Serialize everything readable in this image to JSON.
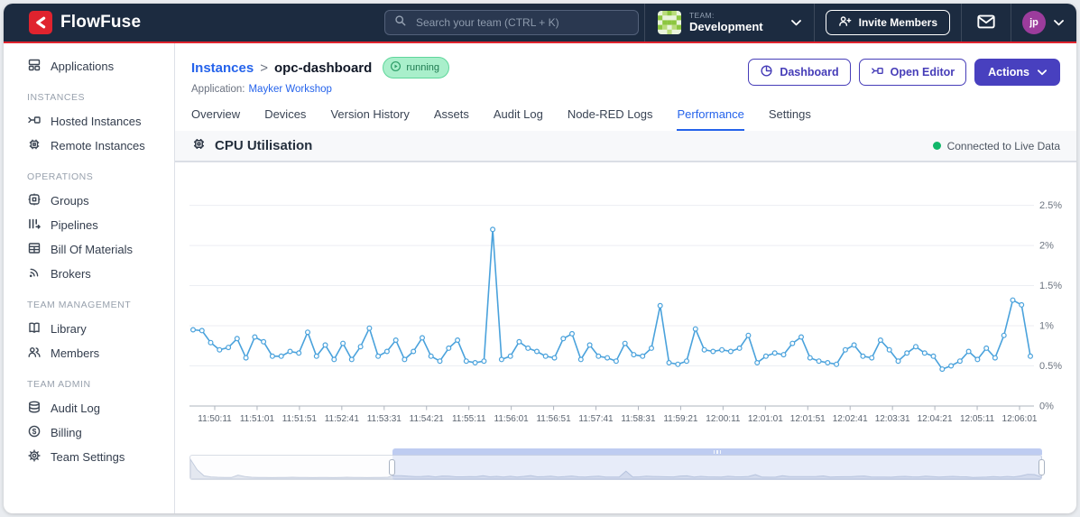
{
  "navbar": {
    "brand": "FlowFuse",
    "search_placeholder": "Search your team (CTRL + K)",
    "team_label": "TEAM:",
    "team_name": "Development",
    "invite_button": "Invite Members",
    "avatar_initials": "jp"
  },
  "sidebar": {
    "sections": [
      {
        "heading": "",
        "items": [
          {
            "label": "Applications"
          }
        ]
      },
      {
        "heading": "INSTANCES",
        "items": [
          {
            "label": "Hosted Instances"
          },
          {
            "label": "Remote Instances"
          }
        ]
      },
      {
        "heading": "OPERATIONS",
        "items": [
          {
            "label": "Groups"
          },
          {
            "label": "Pipelines"
          },
          {
            "label": "Bill Of Materials"
          },
          {
            "label": "Brokers"
          }
        ]
      },
      {
        "heading": "TEAM MANAGEMENT",
        "items": [
          {
            "label": "Library"
          },
          {
            "label": "Members"
          }
        ]
      },
      {
        "heading": "TEAM ADMIN",
        "items": [
          {
            "label": "Audit Log"
          },
          {
            "label": "Billing"
          },
          {
            "label": "Team Settings"
          }
        ]
      }
    ]
  },
  "header": {
    "breadcrumb_parent": "Instances",
    "breadcrumb_separator": ">",
    "instance_name": "opc-dashboard",
    "status_badge": "running",
    "application_label": "Application:",
    "application_name": "Mayker Workshop",
    "buttons": {
      "dashboard": "Dashboard",
      "open_editor": "Open Editor",
      "actions": "Actions"
    }
  },
  "tabs": [
    {
      "label": "Overview"
    },
    {
      "label": "Devices"
    },
    {
      "label": "Version History"
    },
    {
      "label": "Assets"
    },
    {
      "label": "Audit Log"
    },
    {
      "label": "Node-RED Logs"
    },
    {
      "label": "Performance"
    },
    {
      "label": "Settings"
    }
  ],
  "active_tab": "Performance",
  "colors": {
    "navbar_bg": "#1C2B40",
    "accent_red": "#E0232E",
    "link_blue": "#2563EB",
    "indigo": "#4840BF",
    "line_blue": "#4AA2DC",
    "live_green": "#12B76A",
    "badge_bg": "#A9EFCB",
    "badge_text": "#1E7A50"
  },
  "chart_data": {
    "type": "line",
    "title": "CPU Utilisation",
    "status": "Connected to Live Data",
    "unit": "%",
    "interval_seconds": 10,
    "grid": true,
    "legend": false,
    "ylim": [
      0,
      2.9
    ],
    "y_tick_labels": [
      "0%",
      "0.5%",
      "1%",
      "1.5%",
      "2%",
      "2.5%"
    ],
    "x_tick_labels": [
      "11:50:11",
      "11:51:01",
      "11:51:51",
      "11:52:41",
      "11:53:31",
      "11:54:21",
      "11:55:11",
      "11:56:01",
      "11:56:51",
      "11:57:41",
      "11:58:31",
      "11:59:21",
      "12:00:11",
      "12:01:01",
      "12:01:51",
      "12:02:41",
      "12:03:31",
      "12:04:21",
      "12:05:11",
      "12:06:01"
    ],
    "series": [
      {
        "name": "CPU Utilisation %",
        "color": "#4AA2DC",
        "values": [
          0.95,
          0.94,
          0.79,
          0.7,
          0.73,
          0.84,
          0.6,
          0.86,
          0.8,
          0.62,
          0.62,
          0.68,
          0.66,
          0.92,
          0.62,
          0.76,
          0.58,
          0.78,
          0.58,
          0.74,
          0.97,
          0.62,
          0.68,
          0.82,
          0.58,
          0.68,
          0.85,
          0.62,
          0.56,
          0.72,
          0.82,
          0.56,
          0.54,
          0.56,
          2.2,
          0.58,
          0.62,
          0.8,
          0.72,
          0.68,
          0.62,
          0.6,
          0.84,
          0.9,
          0.58,
          0.76,
          0.62,
          0.6,
          0.56,
          0.78,
          0.64,
          0.62,
          0.72,
          1.25,
          0.54,
          0.52,
          0.56,
          0.96,
          0.7,
          0.68,
          0.7,
          0.68,
          0.72,
          0.88,
          0.54,
          0.62,
          0.66,
          0.64,
          0.78,
          0.86,
          0.6,
          0.56,
          0.54,
          0.52,
          0.7,
          0.76,
          0.62,
          0.6,
          0.82,
          0.7,
          0.56,
          0.66,
          0.74,
          0.66,
          0.62,
          0.46,
          0.5,
          0.56,
          0.68,
          0.58,
          0.72,
          0.6,
          0.88,
          1.32,
          1.26,
          0.62
        ]
      }
    ],
    "brush": {
      "selection_start_pct": 23.8,
      "selection_end_pct": 100,
      "ymax": 6.0,
      "lead_in_values": [
        5.5,
        2.6,
        0.9,
        0.6,
        0.5,
        0.45,
        0.42,
        1.1,
        0.7,
        0.5,
        0.45,
        0.42,
        0.4,
        0.42,
        0.45,
        0.5,
        0.45,
        0.42,
        0.4,
        0.45,
        0.42,
        0.4,
        0.44,
        0.5,
        0.46,
        0.42,
        0.4,
        0.42,
        0.45,
        0.5
      ]
    }
  }
}
